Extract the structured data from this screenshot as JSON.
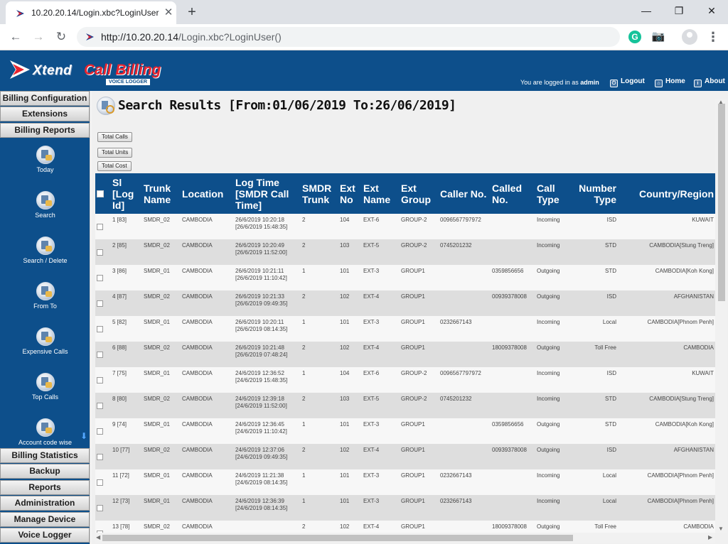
{
  "browser": {
    "tab_title": "10.20.20.14/Login.xbc?LoginUser()",
    "tab_close": "✕",
    "new_tab": "+",
    "url_host": "http://10.20.20.14",
    "url_path": "/Login.xbc?LoginUser()",
    "back_icon": "←",
    "forward_icon": "→",
    "reload_icon": "↻",
    "ext_grammarly": "G",
    "ext_camera": "📷",
    "menu_icon": "⋮",
    "minimize": "—",
    "restore": "❐",
    "close": "✕"
  },
  "header": {
    "logo_xtend": "Xtend",
    "logo_call_billing": "Call Billing",
    "logo_sub": "VOICE LOGGER",
    "logged_in_prefix": "You are logged in as",
    "user": "admin",
    "logout": "Logout",
    "home": "Home",
    "about": "About",
    "colors": {
      "bar": "#0d4f8b",
      "brand_red": "#e8232e"
    }
  },
  "sidebar": {
    "top_menus": [
      "Billing Configuration",
      "Extensions",
      "Billing Reports"
    ],
    "sub_items": [
      "Today",
      "Search",
      "Search / Delete",
      "From To",
      "Expensive Calls",
      "Top Calls",
      "Account code wise"
    ],
    "bottom_menus": [
      "Billing Statistics",
      "Backup",
      "Reports",
      "Administration",
      "Manage Device",
      "Voice Logger"
    ],
    "scroll_icon": "⬇"
  },
  "main": {
    "title": "Search Results [From:01/06/2019 To:26/06/2019]",
    "buttons": [
      "Total Calls",
      "Total Units",
      "Total Cost"
    ],
    "columns": [
      "Sl [Log Id]",
      "Trunk Name",
      "Location",
      "Log Time [SMDR Call Time]",
      "SMDR Trunk",
      "Ext No",
      "Ext Name",
      "Ext Group",
      "Caller No.",
      "Called No.",
      "Call Type",
      "Number Type",
      "Country/Region"
    ],
    "rows": [
      [
        "1 [83]",
        "SMDR_02",
        "CAMBODIA",
        "26/6/2019 10:20:18 [26/6/2019 15:48:35]",
        "2",
        "104",
        "EXT-6",
        "GROUP-2",
        "0096567797972",
        "",
        "Incoming",
        "ISD",
        "KUWAIT"
      ],
      [
        "2 [85]",
        "SMDR_02",
        "CAMBODIA",
        "26/6/2019 10:20:49 [26/6/2019 11:52:00]",
        "2",
        "103",
        "EXT-5",
        "GROUP-2",
        "0745201232",
        "",
        "Incoming",
        "STD",
        "CAMBODIA[Stung Treng]"
      ],
      [
        "3 [86]",
        "SMDR_01",
        "CAMBODIA",
        "26/6/2019 10:21:11 [26/6/2019 11:10:42]",
        "1",
        "101",
        "EXT-3",
        "GROUP1",
        "",
        "0359856656",
        "Outgoing",
        "STD",
        "CAMBODIA[Koh Kong]"
      ],
      [
        "4 [87]",
        "SMDR_02",
        "CAMBODIA",
        "26/6/2019 10:21:33 [26/6/2019 09:49:35]",
        "2",
        "102",
        "EXT-4",
        "GROUP1",
        "",
        "00939378008",
        "Outgoing",
        "ISD",
        "AFGHANISTAN"
      ],
      [
        "5 [82]",
        "SMDR_01",
        "CAMBODIA",
        "26/6/2019 10:20:11 [26/6/2019 08:14:35]",
        "1",
        "101",
        "EXT-3",
        "GROUP1",
        "0232667143",
        "",
        "Incoming",
        "Local",
        "CAMBODIA[Phnom Penh]"
      ],
      [
        "6 [88]",
        "SMDR_02",
        "CAMBODIA",
        "26/6/2019 10:21:48 [26/6/2019 07:48:24]",
        "2",
        "102",
        "EXT-4",
        "GROUP1",
        "",
        "18009378008",
        "Outgoing",
        "Toll Free",
        "CAMBODIA"
      ],
      [
        "7 [75]",
        "SMDR_01",
        "CAMBODIA",
        "24/6/2019 12:36:52 [24/6/2019 15:48:35]",
        "1",
        "104",
        "EXT-6",
        "GROUP-2",
        "0096567797972",
        "",
        "Incoming",
        "ISD",
        "KUWAIT"
      ],
      [
        "8 [80]",
        "SMDR_02",
        "CAMBODIA",
        "24/6/2019 12:39:18 [24/6/2019 11:52:00]",
        "2",
        "103",
        "EXT-5",
        "GROUP-2",
        "0745201232",
        "",
        "Incoming",
        "STD",
        "CAMBODIA[Stung Treng]"
      ],
      [
        "9 [74]",
        "SMDR_01",
        "CAMBODIA",
        "24/6/2019 12:36:45 [24/6/2019 11:10:42]",
        "1",
        "101",
        "EXT-3",
        "GROUP1",
        "",
        "0359856656",
        "Outgoing",
        "STD",
        "CAMBODIA[Koh Kong]"
      ],
      [
        "10 [77]",
        "SMDR_02",
        "CAMBODIA",
        "24/6/2019 12:37:06 [24/6/2019 09:49:35]",
        "2",
        "102",
        "EXT-4",
        "GROUP1",
        "",
        "00939378008",
        "Outgoing",
        "ISD",
        "AFGHANISTAN"
      ],
      [
        "11 [72]",
        "SMDR_01",
        "CAMBODIA",
        "24/6/2019 11:21:38 [24/6/2019 08:14:35]",
        "1",
        "101",
        "EXT-3",
        "GROUP1",
        "0232667143",
        "",
        "Incoming",
        "Local",
        "CAMBODIA[Phnom Penh]"
      ],
      [
        "12 [73]",
        "SMDR_01",
        "CAMBODIA",
        "24/6/2019 12:36:39 [24/6/2019 08:14:35]",
        "1",
        "101",
        "EXT-3",
        "GROUP1",
        "0232667143",
        "",
        "Incoming",
        "Local",
        "CAMBODIA[Phnom Penh]"
      ],
      [
        "13 [78]",
        "SMDR_02",
        "CAMBODIA",
        "",
        "2",
        "102",
        "EXT-4",
        "GROUP1",
        "",
        "18009378008",
        "Outgoing",
        "Toll Free",
        "CAMBODIA"
      ]
    ]
  }
}
